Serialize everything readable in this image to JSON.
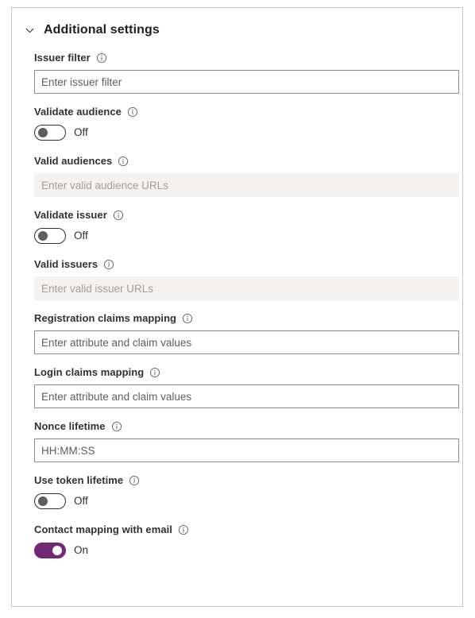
{
  "section": {
    "title": "Additional settings",
    "expanded": true,
    "chevron_icon": "chevron-down-icon"
  },
  "colors": {
    "toggle_on": "#742774",
    "toggle_off_thumb": "#605e5c",
    "border": "#8a8886",
    "card_border": "#c8c6c4",
    "disabled_background": "#f3f2f1",
    "text": "#323130"
  },
  "fields": [
    {
      "key": "issuer_filter",
      "type": "text",
      "label": "Issuer filter",
      "info_icon": "info-icon",
      "value": "",
      "placeholder": "Enter issuer filter",
      "disabled": false
    },
    {
      "key": "validate_audience",
      "type": "toggle",
      "label": "Validate audience",
      "info_icon": "info-icon",
      "state_label": "Off",
      "on": false
    },
    {
      "key": "valid_audiences",
      "type": "text",
      "label": "Valid audiences",
      "info_icon": "info-icon",
      "value": "",
      "placeholder": "Enter valid audience URLs",
      "disabled": true
    },
    {
      "key": "validate_issuer",
      "type": "toggle",
      "label": "Validate issuer",
      "info_icon": "info-icon",
      "state_label": "Off",
      "on": false
    },
    {
      "key": "valid_issuers",
      "type": "text",
      "label": "Valid issuers",
      "info_icon": "info-icon",
      "value": "",
      "placeholder": "Enter valid issuer URLs",
      "disabled": true
    },
    {
      "key": "registration_claims_mapping",
      "type": "text",
      "label": "Registration claims mapping",
      "info_icon": "info-icon",
      "value": "",
      "placeholder": "Enter attribute and claim values",
      "disabled": false
    },
    {
      "key": "login_claims_mapping",
      "type": "text",
      "label": "Login claims mapping",
      "info_icon": "info-icon",
      "value": "",
      "placeholder": "Enter attribute and claim values",
      "disabled": false
    },
    {
      "key": "nonce_lifetime",
      "type": "text",
      "label": "Nonce lifetime",
      "info_icon": "info-icon",
      "value": "",
      "placeholder": "HH:MM:SS",
      "disabled": false
    },
    {
      "key": "use_token_lifetime",
      "type": "toggle",
      "label": "Use token lifetime",
      "info_icon": "info-icon",
      "state_label": "Off",
      "on": false
    },
    {
      "key": "contact_mapping_with_email",
      "type": "toggle",
      "label": "Contact mapping with email",
      "info_icon": "info-icon",
      "state_label": "On",
      "on": true
    }
  ]
}
